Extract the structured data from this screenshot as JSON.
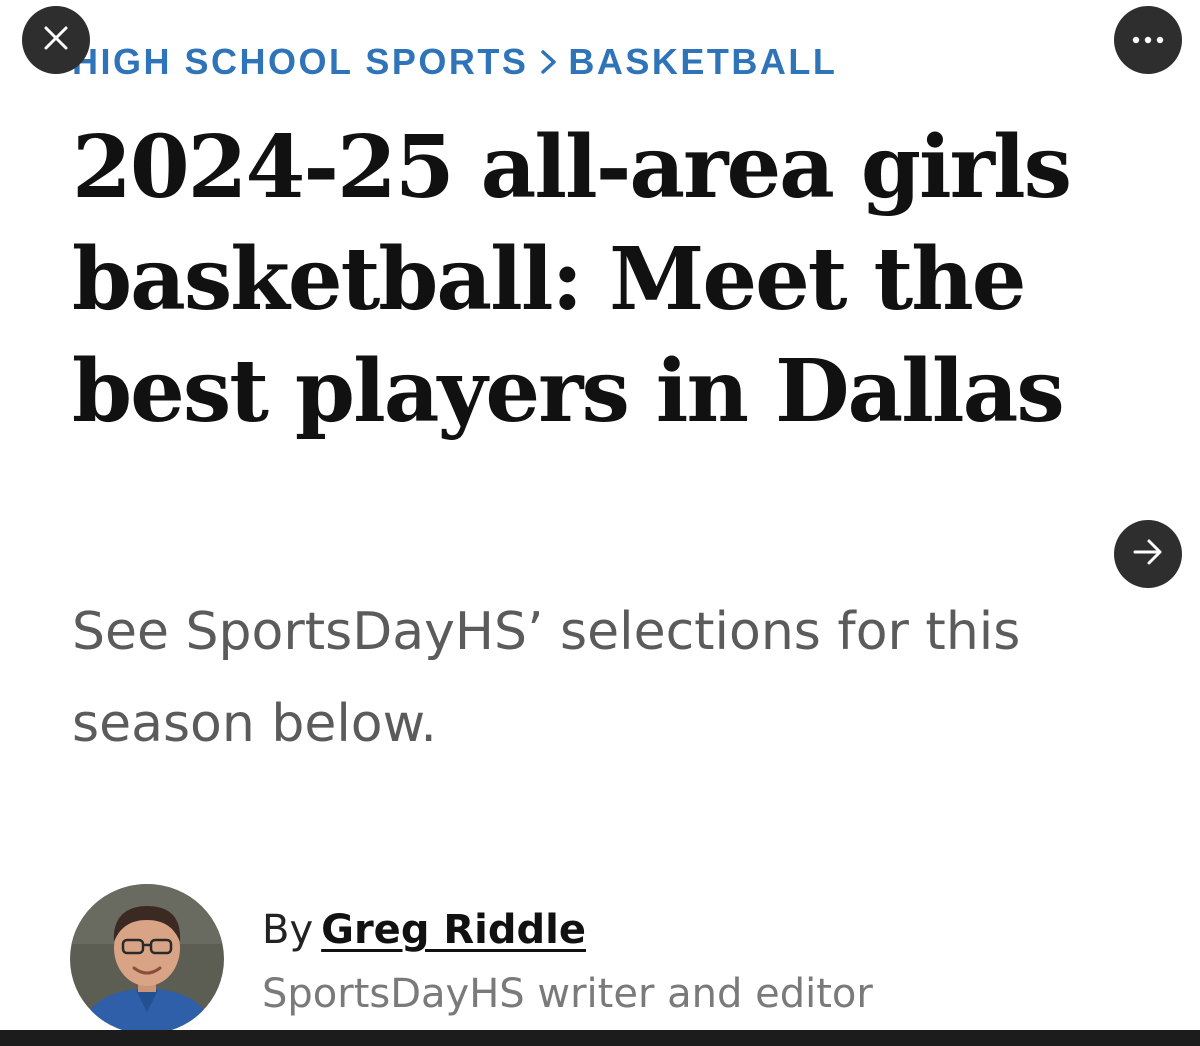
{
  "breadcrumb": {
    "section": "HIGH SCHOOL SPORTS",
    "subsection": "BASKETBALL"
  },
  "article": {
    "headline": "2024-25 all-area girls basketball: Meet the best players in Dallas",
    "subheadline": "See SportsDayHS’ selections for this season below."
  },
  "author": {
    "by_label": "By",
    "name": "Greg Riddle",
    "role": "SportsDayHS writer and editor"
  },
  "controls": {
    "close_icon": "close-icon",
    "more_icon": "more-options-icon",
    "next_icon": "arrow-right-icon"
  },
  "colors": {
    "breadcrumb": "#2f73b8",
    "headline": "#111111",
    "subhead": "#5b5b5b",
    "control_bg": "#2e2e2e"
  }
}
